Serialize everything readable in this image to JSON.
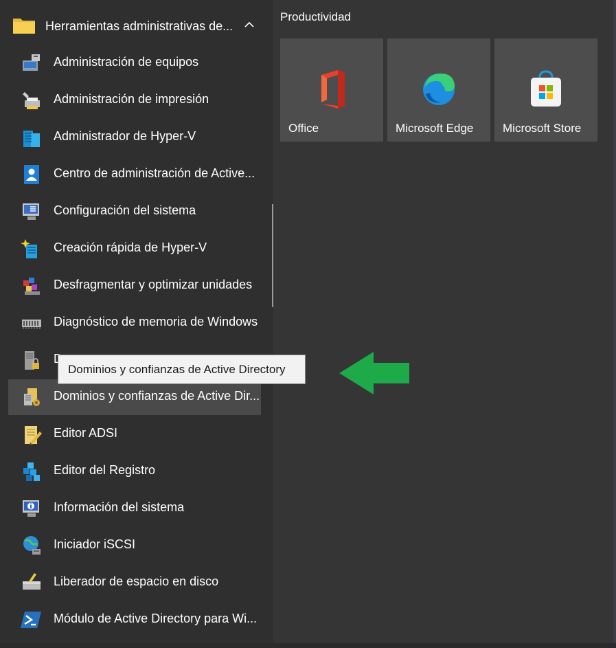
{
  "folder": {
    "label": "Herramientas administrativas de...",
    "icon": "folder-icon",
    "expanded": true
  },
  "items": [
    {
      "label": "Administración de equipos",
      "icon": "computer-management-icon"
    },
    {
      "label": "Administración de impresión",
      "icon": "print-management-icon"
    },
    {
      "label": "Administrador de Hyper-V",
      "icon": "hyper-v-manager-icon"
    },
    {
      "label": "Centro de administración de Active...",
      "icon": "active-directory-admin-center-icon"
    },
    {
      "label": "Configuración del sistema",
      "icon": "system-configuration-icon"
    },
    {
      "label": "Creación rápida de Hyper-V",
      "icon": "hyper-v-quick-create-icon"
    },
    {
      "label": "Desfragmentar y optimizar unidades",
      "icon": "defragment-icon"
    },
    {
      "label": "Diagnóstico de memoria de Windows",
      "icon": "memory-diagnostic-icon"
    },
    {
      "label": "D",
      "icon": "server-lock-icon"
    },
    {
      "label": "Dominios y confianzas de Active Dir...",
      "icon": "domains-trusts-icon",
      "selected": true
    },
    {
      "label": "Editor ADSI",
      "icon": "adsi-edit-icon"
    },
    {
      "label": "Editor del Registro",
      "icon": "registry-editor-icon"
    },
    {
      "label": "Información del sistema",
      "icon": "system-information-icon"
    },
    {
      "label": "Iniciador iSCSI",
      "icon": "iscsi-initiator-icon"
    },
    {
      "label": "Liberador de espacio en disco",
      "icon": "disk-cleanup-icon"
    },
    {
      "label": "Módulo de Active Directory para Wi...",
      "icon": "powershell-icon"
    }
  ],
  "tooltip": {
    "text": "Dominios y confianzas de Active Directory"
  },
  "pinned": {
    "section_title": "Productividad",
    "tiles": [
      {
        "label": "Office",
        "icon": "office-icon"
      },
      {
        "label": "Microsoft Edge",
        "icon": "edge-icon"
      },
      {
        "label": "Microsoft Store",
        "icon": "store-icon"
      }
    ]
  },
  "colors": {
    "arrow": "#1faa4a",
    "tile": "#4d4d4d",
    "selected": "#4a4a4a",
    "tooltip_bg": "#f2f2f2"
  }
}
